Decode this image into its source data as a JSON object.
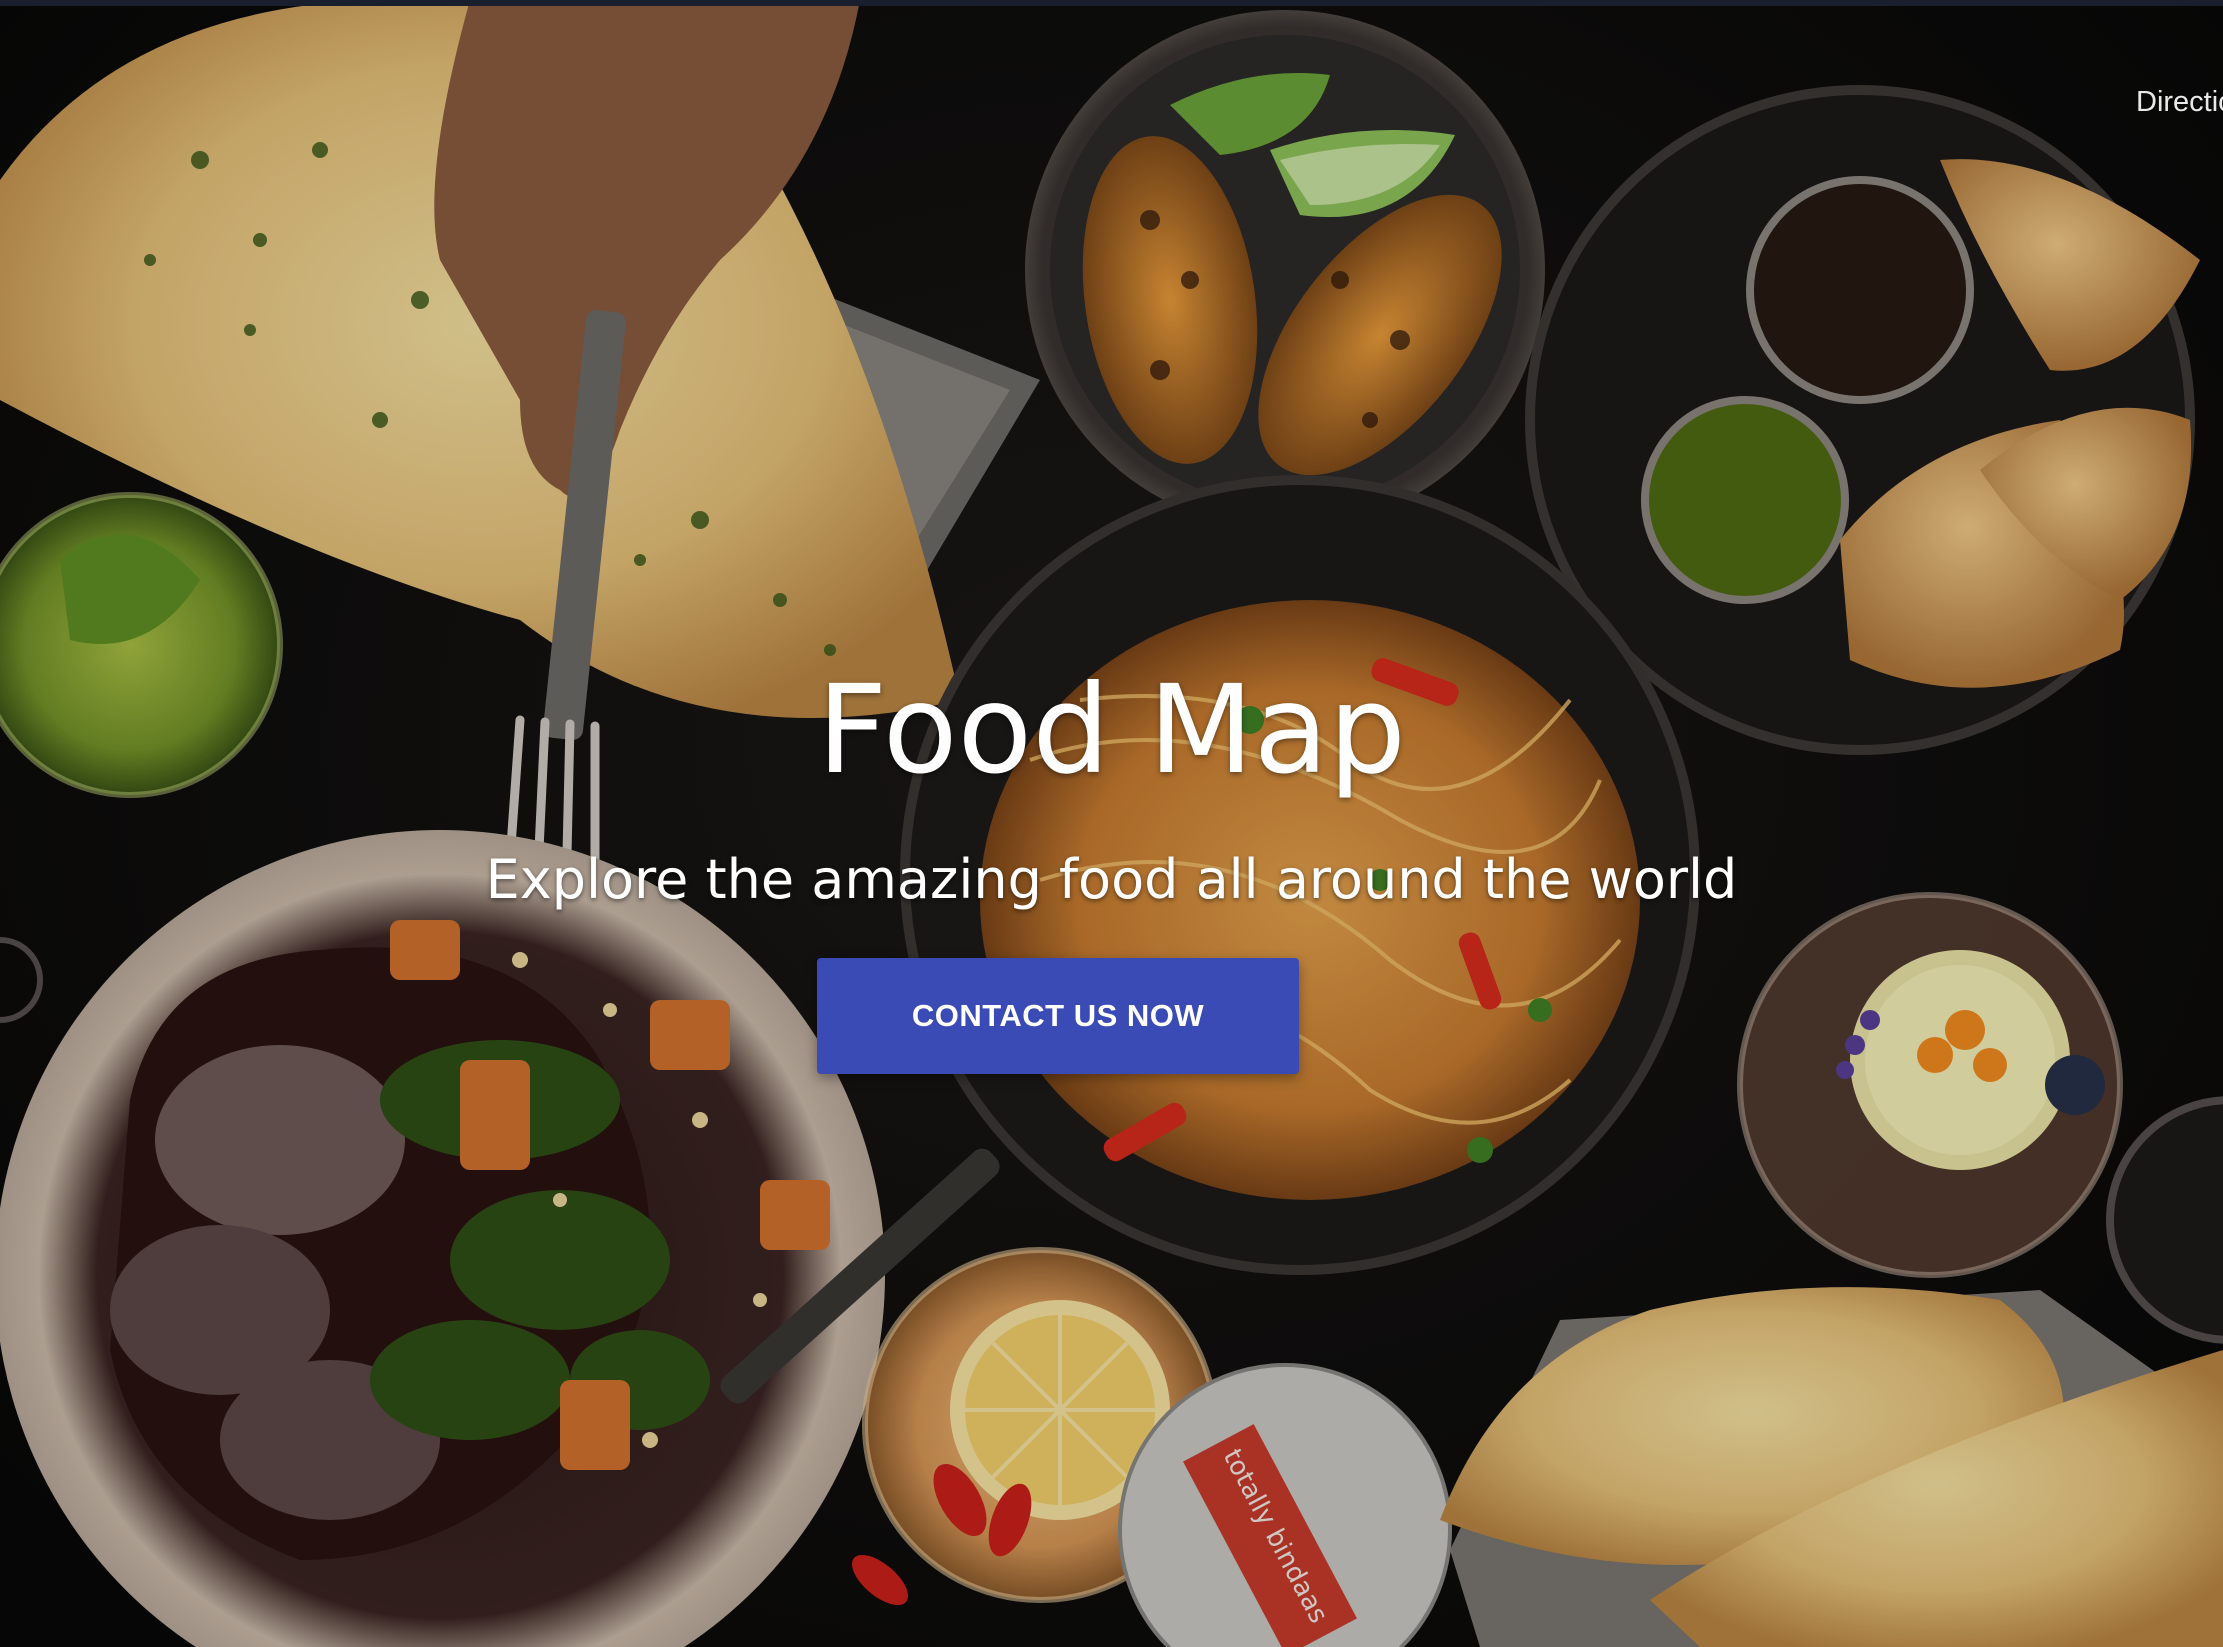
{
  "nav": {
    "link_label": "Directions"
  },
  "hero": {
    "title": "Food Map",
    "subtitle": "Explore the amazing food all around the world",
    "cta_label": "CONTACT US NOW",
    "coaster_text": "totally bindaas"
  },
  "colors": {
    "cta_background": "#3a4bb6",
    "text": "#ffffff",
    "page_background": "#0b0b0d"
  }
}
